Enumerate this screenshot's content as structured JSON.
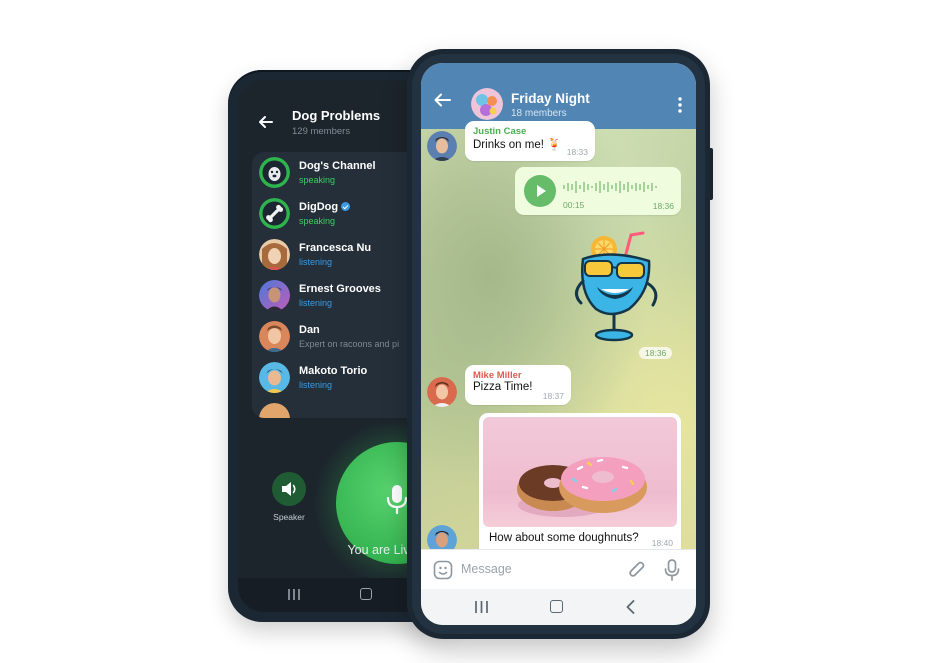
{
  "voice_chat": {
    "title": "Dog Problems",
    "subtitle": "129 members",
    "participants": [
      {
        "name": "Dog's Channel",
        "status": "speaking",
        "status_type": "speaking",
        "verified": false
      },
      {
        "name": "DigDog",
        "status": "speaking",
        "status_type": "speaking",
        "verified": true
      },
      {
        "name": "Francesca Nu",
        "status": "listening",
        "status_type": "listening",
        "verified": false
      },
      {
        "name": "Ernest Grooves",
        "status": "listening",
        "status_type": "listening",
        "verified": false
      },
      {
        "name": "Dan",
        "status": "Expert on racoons and pi",
        "status_type": "muted",
        "verified": false
      },
      {
        "name": "Makoto Torio",
        "status": "listening",
        "status_type": "listening",
        "verified": false
      }
    ],
    "speaker_label": "Speaker",
    "live_label": "You are Live"
  },
  "chat": {
    "title": "Friday Night",
    "subtitle": "18 members",
    "messages": [
      {
        "sender": "Justin Case",
        "sender_color": "#4caf50",
        "text": "Drinks on me! 🍹",
        "time": "18:33"
      },
      {
        "type": "voice",
        "duration": "00:15",
        "time": "18:36"
      },
      {
        "type": "sticker",
        "time": "18:36"
      },
      {
        "sender": "Mike Miller",
        "sender_color": "#e05a4f",
        "text": "Pizza Time!",
        "time": "18:37"
      },
      {
        "type": "photo",
        "caption": "How about some doughnuts?",
        "time": "18:40"
      }
    ],
    "input_placeholder": "Message"
  },
  "colors": {
    "header_blue": "#5186b4",
    "speaking_green": "#3fcf61",
    "listening_blue": "#3a9be3",
    "outgoing_bubble": "#effdde",
    "phone_frame": "#1b2833"
  }
}
